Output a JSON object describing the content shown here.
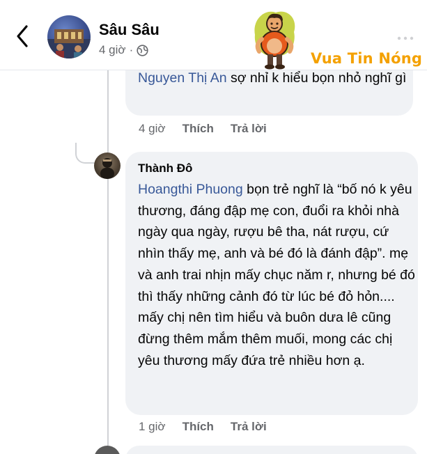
{
  "header": {
    "page_name": "Sâu Sâu",
    "time": "4 giờ",
    "separator": "·"
  },
  "watermark": {
    "text": "Vua Tin Nóng"
  },
  "comments": [
    {
      "mention": "Nguyen Thị An",
      "text": " sợ nhỉ k hiểu bọn nhỏ nghĩ gì",
      "time": "4 giờ",
      "like_label": "Thích",
      "reply_label": "Trả lời"
    },
    {
      "author": "Thành Đô",
      "mention": "Hoangthi Phuong",
      "text": " bọn trẻ nghĩ là “bố nó k yêu thương, đáng đập mẹ con, đuổi ra khỏi nhà ngày qua ngày, rượu bê tha, nát rượu, cứ nhìn thấy mẹ, anh và bé đó là đánh đập”. mẹ và anh trai nhịn mấy chục năm r, nhưng bé đó thì thấy những cảnh đó từ lúc bé đỏ hỏn.... mấy chị nên tìm hiểu và buôn dưa lê cũng đừng thêm mắm thêm muối, mong các chị yêu thương mấy đứa trẻ nhiều hơn ạ.",
      "time": "1 giờ",
      "like_label": "Thích",
      "reply_label": "Trả lời"
    }
  ],
  "colors": {
    "mention": "#385898",
    "bubble": "#f0f2f5",
    "meta": "#65676b",
    "watermark": "#f4a100"
  },
  "icons": [
    "back-arrow-icon",
    "globe-icon",
    "more-icon"
  ]
}
